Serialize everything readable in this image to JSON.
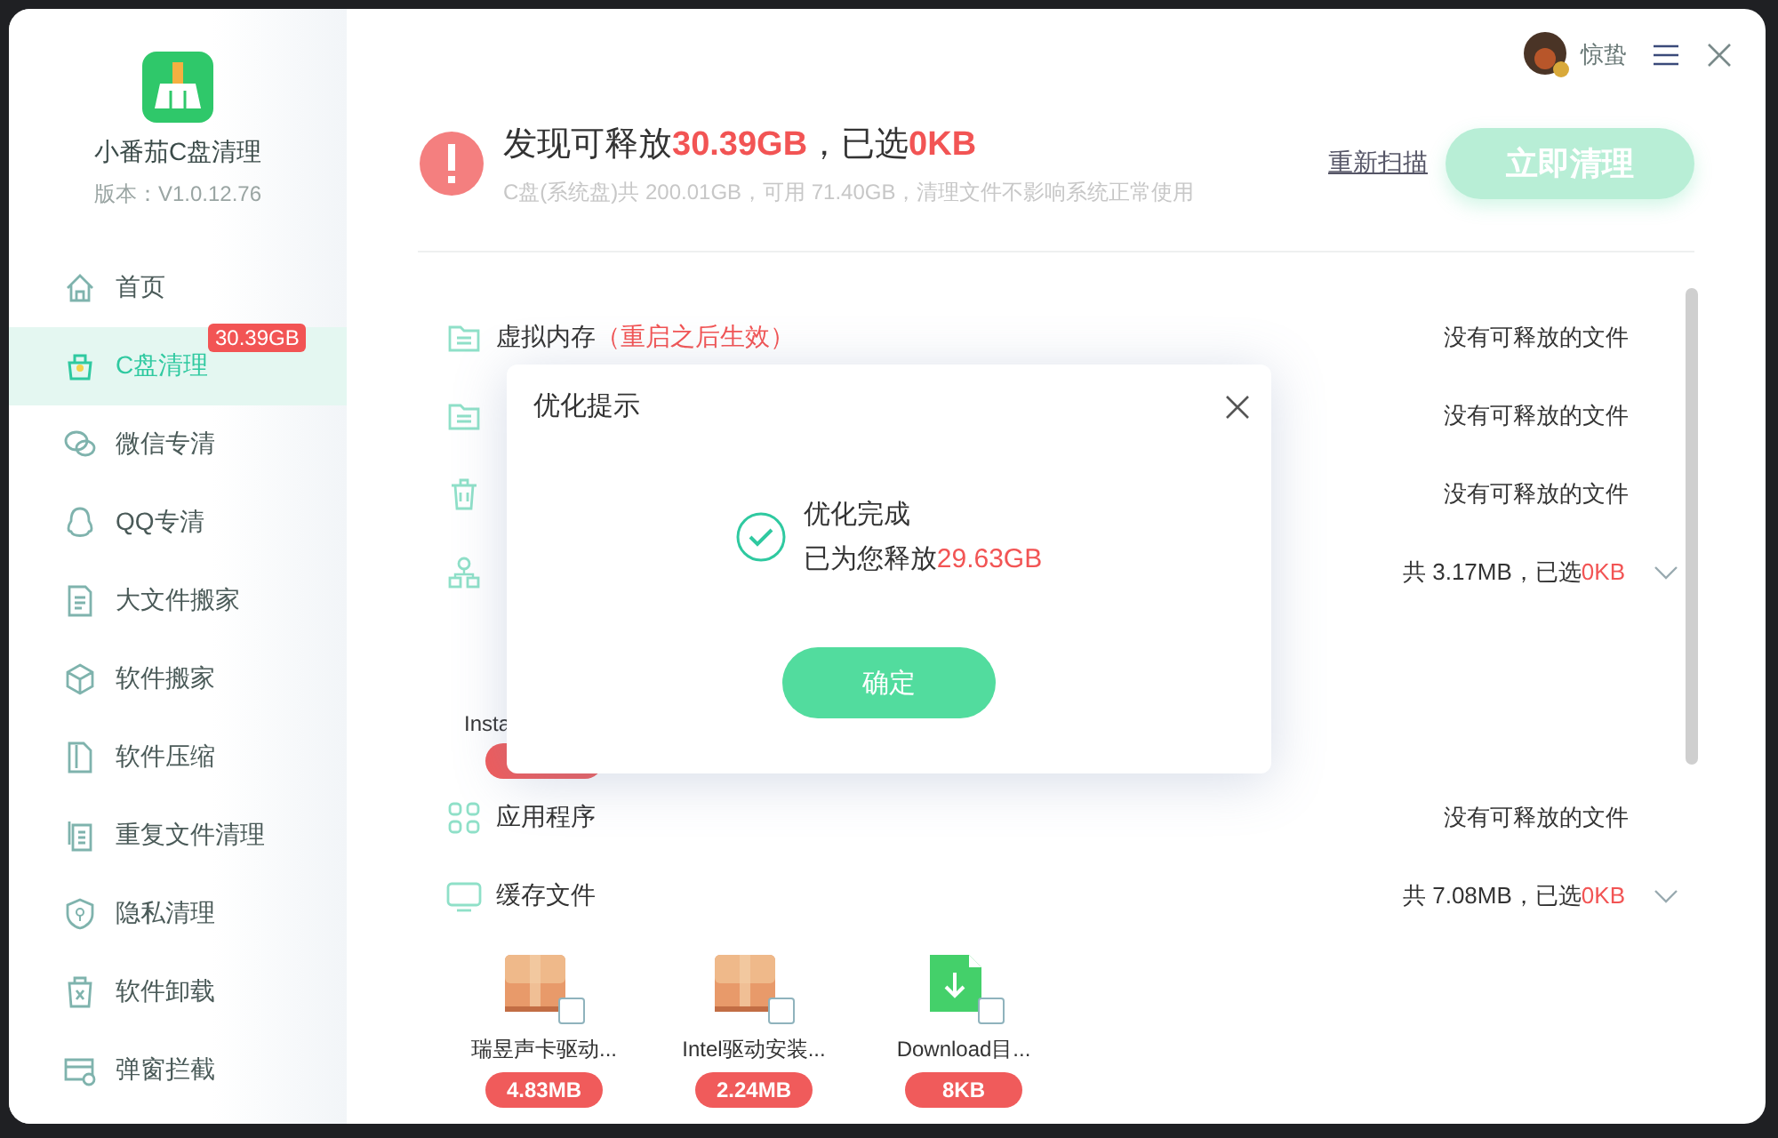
{
  "sidebar": {
    "app_name": "小番茄C盘清理",
    "version": "版本：V1.0.12.76",
    "items": [
      {
        "label": "首页",
        "selected": false
      },
      {
        "label": "C盘清理",
        "selected": true,
        "badge": "30.39GB"
      },
      {
        "label": "微信专清",
        "selected": false
      },
      {
        "label": "QQ专清",
        "selected": false
      },
      {
        "label": "大文件搬家",
        "selected": false
      },
      {
        "label": "软件搬家",
        "selected": false
      },
      {
        "label": "软件压缩",
        "selected": false
      },
      {
        "label": "重复文件清理",
        "selected": false
      },
      {
        "label": "隐私清理",
        "selected": false
      },
      {
        "label": "软件卸载",
        "selected": false
      },
      {
        "label": "弹窗拦截",
        "selected": false
      }
    ]
  },
  "user": {
    "name": "惊蛰"
  },
  "summary": {
    "title_prefix": "发现可释放",
    "found": "30.39GB",
    "title_mid": "，已选",
    "selected_size": "0KB",
    "subtitle": "C盘(系统盘)共 200.01GB，可用 71.40GB，清理文件不影响系统正常使用",
    "rescan_link": "重新扫描",
    "clean_button": {
      "label": "立即清理",
      "disabled": true
    }
  },
  "categories": [
    {
      "kind": "empty",
      "label": "虚拟内存",
      "note": "（重启之后生效）",
      "status": "没有可释放的文件"
    },
    {
      "kind": "empty",
      "status": "没有可释放的文件"
    },
    {
      "kind": "empty",
      "status": "没有可释放的文件"
    },
    {
      "kind": "summary",
      "total": "共 3.17MB，已选",
      "selected_size": "0KB",
      "items": [
        {
          "name": "Insta"
        }
      ]
    },
    {
      "kind": "empty",
      "label": "应用程序",
      "status": "没有可释放的文件"
    },
    {
      "kind": "summary",
      "label": "缓存文件",
      "total": "共 7.08MB，已选",
      "selected_size": "0KB",
      "items": [
        {
          "name": "瑞昱声卡驱动...",
          "size": "4.83MB",
          "kind": "package",
          "checked": false
        },
        {
          "name": "Intel驱动安装...",
          "size": "2.24MB",
          "kind": "package",
          "checked": false
        },
        {
          "name": "Download目...",
          "size": "8KB",
          "kind": "download",
          "checked": false
        }
      ]
    }
  ],
  "dialog": {
    "title": "优化提示",
    "heading": "优化完成",
    "message": "已为您释放",
    "amount": "29.63GB",
    "ok_button": "确定"
  }
}
